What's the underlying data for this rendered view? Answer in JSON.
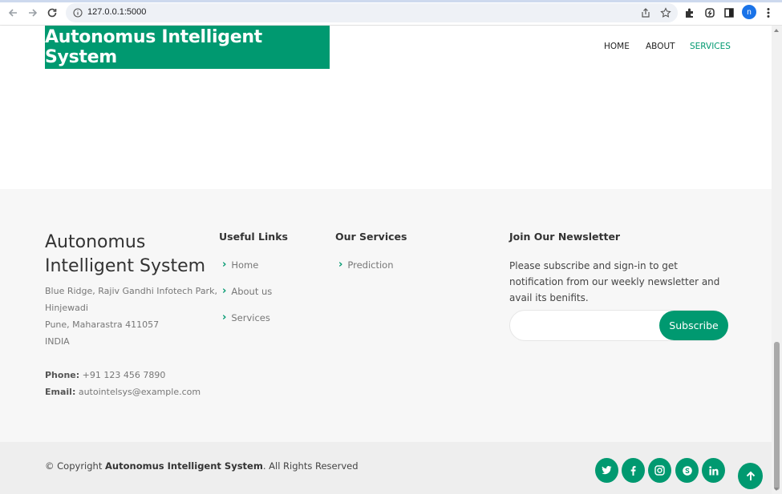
{
  "browser": {
    "url": "127.0.0.1:5000",
    "profile_initial": "n"
  },
  "header": {
    "logo": "Autonomus Intelligent System",
    "nav": [
      {
        "label": "HOME"
      },
      {
        "label": "ABOUT"
      },
      {
        "label": "SERVICES",
        "active": true
      }
    ]
  },
  "footer": {
    "brand": {
      "title_line1": "Autonomus",
      "title_line2": "Intelligent System",
      "address": [
        "Blue Ridge, Rajiv Gandhi Infotech Park,",
        "Hinjewadi",
        "Pune, Maharastra 411057",
        "INDIA"
      ],
      "phone_label": "Phone:",
      "phone": "+91 123 456 7890",
      "email_label": "Email:",
      "email": "autointelsys@example.com"
    },
    "useful_links": {
      "title": "Useful Links",
      "items": [
        "Home",
        "About us",
        "Services"
      ]
    },
    "our_services": {
      "title": "Our Services",
      "items": [
        "Prediction"
      ]
    },
    "newsletter": {
      "title": "Join Our Newsletter",
      "text": "Please subscribe and sign-in to get notification from our weekly newsletter and avail its benifits.",
      "input_value": "",
      "button": "Subscribe"
    },
    "bottom": {
      "copyright_prefix": "© Copyright",
      "copyright_brand": "Autonomus Intelligent System",
      "copyright_suffix": ". All Rights Reserved",
      "social_icons": [
        "twitter-icon",
        "facebook-icon",
        "instagram-icon",
        "skype-icon",
        "linkedin-icon"
      ]
    }
  },
  "colors": {
    "accent": "#009970",
    "footer_bg": "#f7f7f7",
    "footer_bottom_bg": "#eeeeee"
  }
}
